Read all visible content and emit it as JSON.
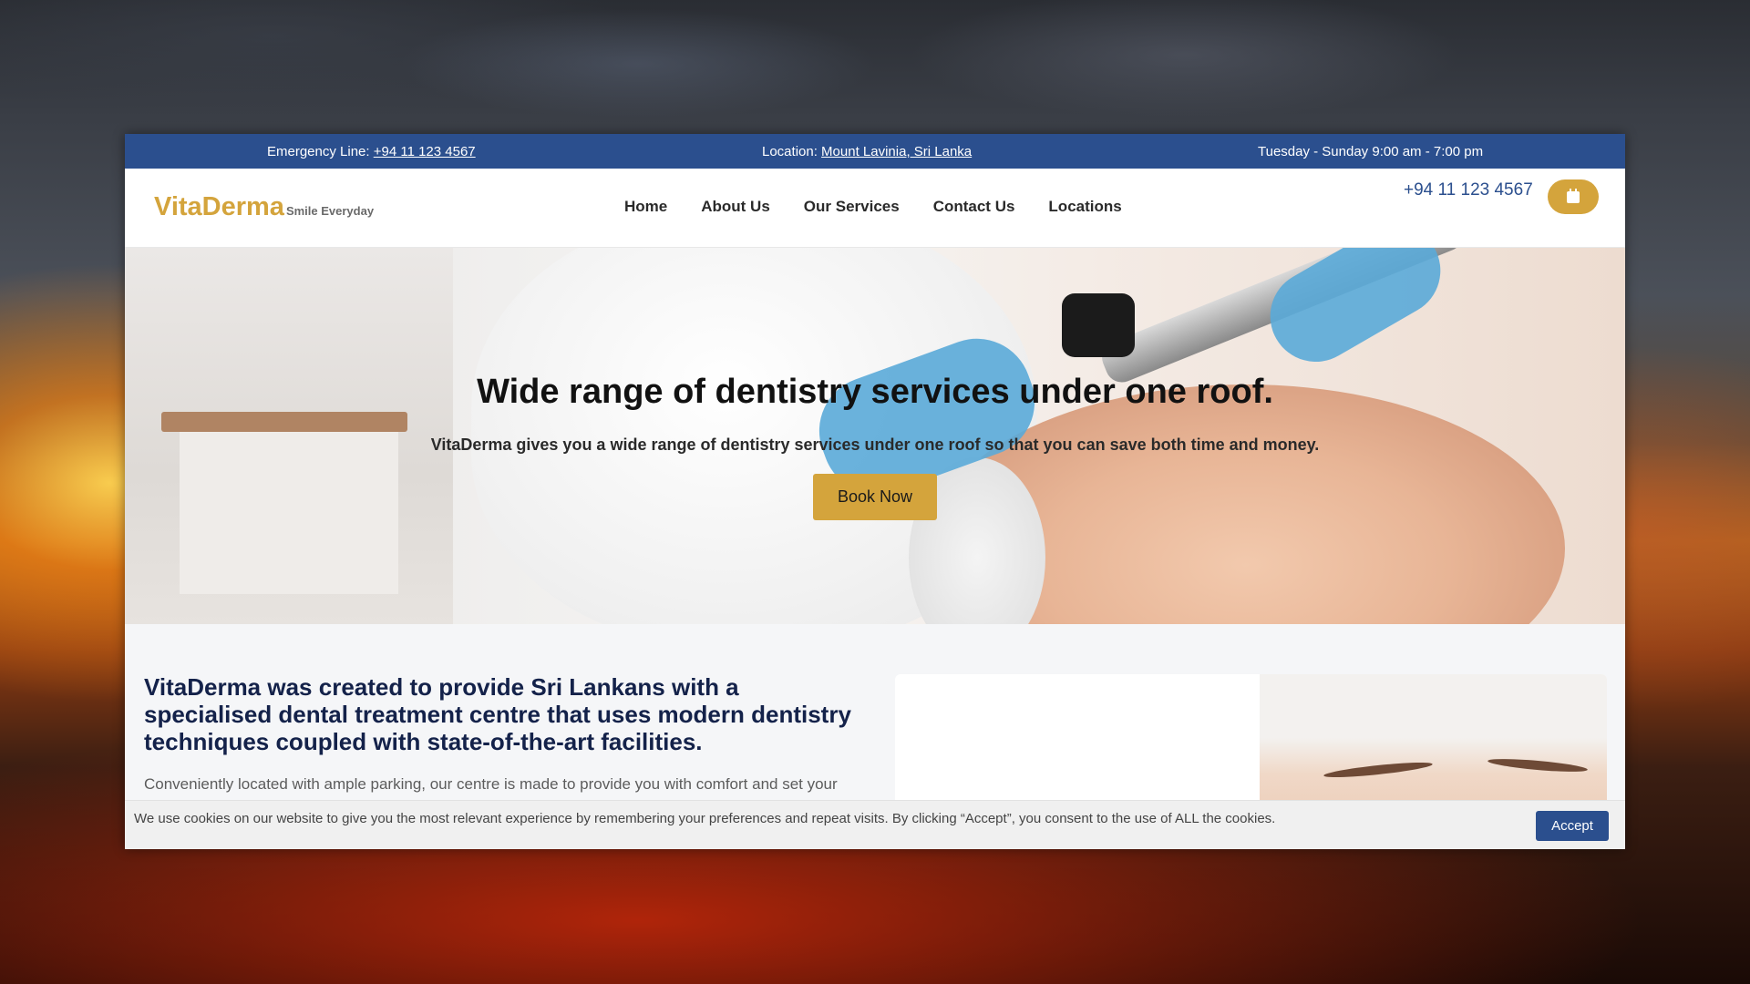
{
  "topbar": {
    "emergency_label": "Emergency Line: ",
    "emergency_phone": "+94 11 123 4567",
    "location_label": "Location: ",
    "location_value": "Mount Lavinia, Sri Lanka",
    "hours": "Tuesday - Sunday 9:00 am - 7:00 pm"
  },
  "header": {
    "logo_main": "VitaDerma",
    "logo_tagline": "Smile Everyday",
    "nav": [
      "Home",
      "About Us",
      "Our Services",
      "Contact Us",
      "Locations"
    ],
    "phone": "+94 11 123 4567",
    "appointment_icon": "calendar-icon"
  },
  "hero": {
    "title": "Wide range of dentistry services under one roof.",
    "subtitle": "VitaDerma gives you a wide range of dentistry services under one roof so that you can save both time and money.",
    "button": "Book Now"
  },
  "about": {
    "title": "VitaDerma was created to provide Sri Lankans with a specialised dental treatment centre that uses modern dentistry techniques coupled with state-of-the-art facilities.",
    "text": "Conveniently located with ample parking, our centre is made to provide you with comfort and set your"
  },
  "cookie": {
    "text": "We use cookies on our website to give you the most relevant experience by remembering your preferences and repeat visits. By clicking “Accept”, you consent to the use of ALL the cookies.",
    "accept": "Accept"
  },
  "colors": {
    "brand_blue": "#2b4f8e",
    "brand_gold": "#d4a43c",
    "heading_navy": "#14224a"
  }
}
